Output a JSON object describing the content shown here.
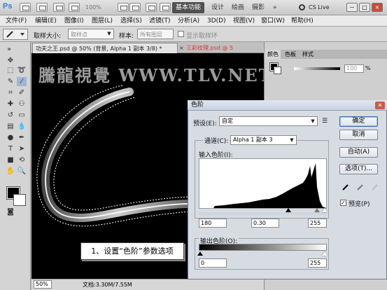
{
  "titlebar": {
    "logo": "Ps",
    "zoom": "100%",
    "workspaces": [
      "基本功能",
      "设计",
      "绘画",
      "摄影"
    ],
    "more": "»",
    "cs_live": "CS Live",
    "window_buttons": [
      "－",
      "□",
      "×"
    ]
  },
  "menubar": [
    "文件(F)",
    "编辑(E)",
    "图像(I)",
    "图层(L)",
    "选择(S)",
    "滤镜(T)",
    "分析(A)",
    "3D(D)",
    "视图(V)",
    "窗口(W)",
    "帮助(H)"
  ],
  "options": {
    "sample_size_label": "取样大小:",
    "sample_size_value": "取样点",
    "sample_label": "样本:",
    "sample_value": "所有图层",
    "show_ring_label": "显示取样环"
  },
  "document": {
    "tabs": [
      {
        "label": "功夫之王.psd @ 50% (背景, Alpha 1 副本 3/8) *",
        "active": true
      },
      {
        "label": "三彩纹理.psd @ 5",
        "active": false
      }
    ],
    "close_label": "×",
    "watermark": "騰龍視覺 WWW.TLV.NET",
    "zoom": "50%",
    "doc_info": "文档:3.30M/7.55M"
  },
  "right_panel": {
    "tabs": [
      "颜色",
      "色板",
      "样式"
    ],
    "k_value": "100",
    "k_unit": "%"
  },
  "levels": {
    "title": "色阶",
    "preset_label": "预设(E):",
    "preset_value": "自定",
    "channel_label": "通道(C):",
    "channel_value": "Alpha 1 副本 3",
    "input_label": "输入色阶(I):",
    "input_values": [
      "180",
      "0.30",
      "255"
    ],
    "output_label": "输出色阶(O):",
    "output_values": [
      "0",
      "255"
    ],
    "buttons": {
      "ok": "确定",
      "cancel": "取消",
      "auto": "自动(A)",
      "options": "选项(T)..."
    },
    "preview_label": "预览(P)",
    "preview_checked": true
  },
  "callout": "1、设置“色阶”参数选项"
}
